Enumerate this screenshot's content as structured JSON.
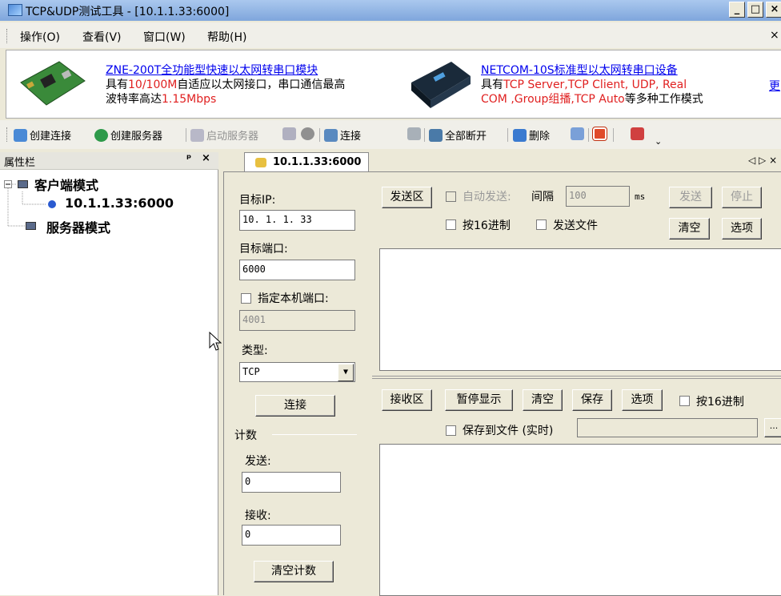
{
  "window": {
    "title": "TCP&UDP测试工具 - [10.1.1.33:6000]",
    "min_label": "_",
    "max_label": "□",
    "close_label": "×"
  },
  "menu": {
    "items": [
      "操作(O)",
      "查看(V)",
      "窗口(W)",
      "帮助(H)"
    ],
    "close": "×"
  },
  "banner": {
    "ad1": {
      "title": "ZNE-200T全功能型快速以太网转串口模块",
      "line1_a": "具有",
      "line1_b": "10/100M",
      "line1_c": "自适应以太网接口，串口通信最高",
      "line2_a": "波特率高达",
      "line2_b": "1.15Mbps"
    },
    "ad2": {
      "title": "NETCOM-10S标准型以太网转串口设备",
      "line1_a": "具有",
      "line1_b": "TCP Server,TCP Client, UDP, Real",
      "line2_a": "COM ,Group组播,TCP Auto",
      "line2_b": "等多种工作模式"
    },
    "more": "更"
  },
  "toolbar": {
    "create_conn": "创建连接",
    "create_server": "创建服务器",
    "start_server": "启动服务器",
    "connect": "连接",
    "disconnect_all": "全部断开",
    "delete": "删除",
    "more": "⌄"
  },
  "sidebar": {
    "title": "属性栏",
    "pin": "ᵖ",
    "close": "×",
    "tree": {
      "client_mode": "客户端模式",
      "connection": "10.1.1.33:6000",
      "server_mode": "服务器模式"
    }
  },
  "tab": {
    "label": "10.1.1.33:6000",
    "nav": "◁ ▷ ×"
  },
  "form": {
    "target_ip_label": "目标IP:",
    "target_ip": "10. 1. 1. 33",
    "target_port_label": "目标端口:",
    "target_port": "6000",
    "local_port_label": "指定本机端口:",
    "local_port": "4001",
    "type_label": "类型:",
    "type_value": "TCP",
    "connect_button": "连接",
    "count_label": "计数",
    "send_label": "发送:",
    "send_value": "0",
    "recv_label": "接收:",
    "recv_value": "0",
    "clear_count_button": "清空计数"
  },
  "send": {
    "area_button": "发送区",
    "auto_send": "自动发送:",
    "interval_label": "间隔",
    "interval_value": "100",
    "unit": "ms",
    "send_button": "发送",
    "stop_button": "停止",
    "hex_label": "按16进制",
    "file_label": "发送文件",
    "clear_button": "清空",
    "options_button": "选项"
  },
  "recv": {
    "area_button": "接收区",
    "pause_button": "暂停显示",
    "clear_button": "清空",
    "save_button": "保存",
    "options_button": "选项",
    "hex_label": "按16进制",
    "save_file_label": "保存到文件 (实时)",
    "browse": "..."
  }
}
